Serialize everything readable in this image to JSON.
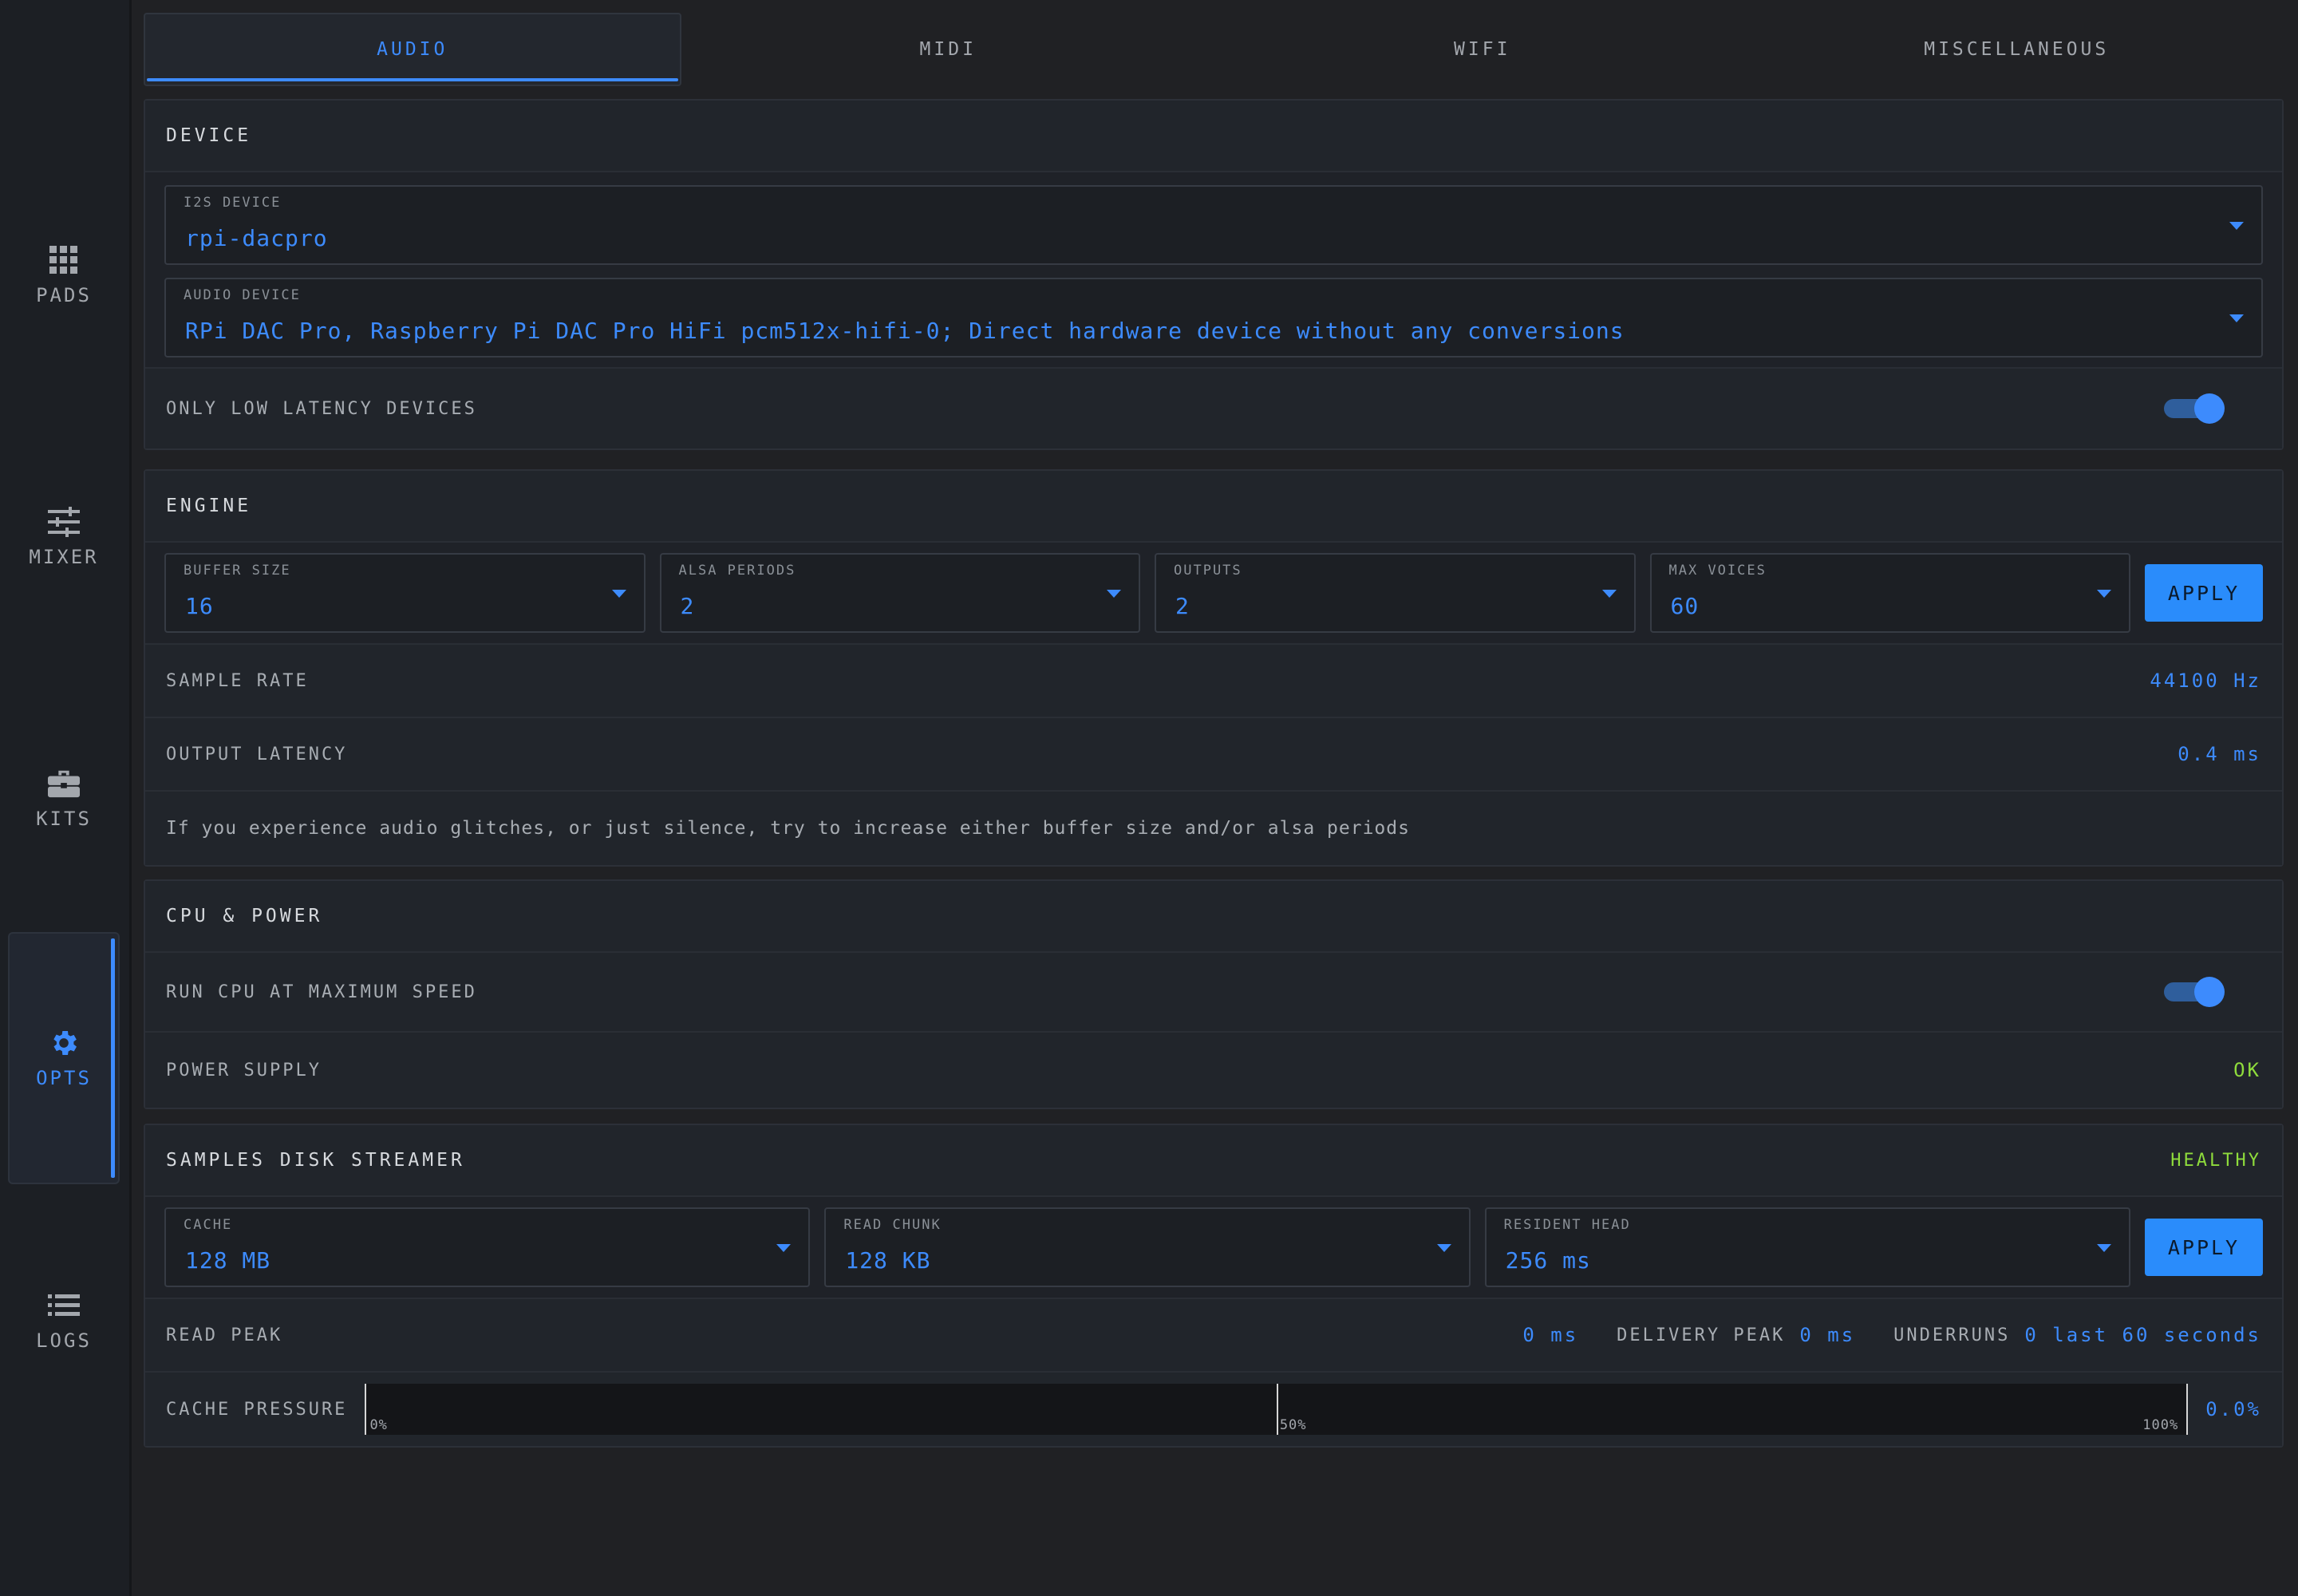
{
  "nav": {
    "items": [
      {
        "label": "PADS",
        "icon": "grid-icon"
      },
      {
        "label": "MIXER",
        "icon": "sliders-icon"
      },
      {
        "label": "KITS",
        "icon": "briefcase-icon"
      },
      {
        "label": "OPTS",
        "icon": "gear-icon"
      },
      {
        "label": "LOGS",
        "icon": "list-icon"
      }
    ],
    "active": "OPTS"
  },
  "tabs": [
    {
      "label": "AUDIO",
      "active": true
    },
    {
      "label": "MIDI"
    },
    {
      "label": "WIFI"
    },
    {
      "label": "MISCELLANEOUS"
    }
  ],
  "device": {
    "title": "DEVICE",
    "i2s_label": "I2S DEVICE",
    "i2s_value": "rpi-dacpro",
    "audio_label": "AUDIO DEVICE",
    "audio_value": "RPi DAC Pro, Raspberry Pi DAC Pro HiFi pcm512x-hifi-0; Direct hardware device without any conversions",
    "low_latency_label": "ONLY LOW LATENCY DEVICES",
    "low_latency_on": true
  },
  "engine": {
    "title": "ENGINE",
    "buffer_label": "BUFFER SIZE",
    "buffer_value": "16",
    "periods_label": "ALSA PERIODS",
    "periods_value": "2",
    "outputs_label": "OUTPUTS",
    "outputs_value": "2",
    "voices_label": "MAX VOICES",
    "voices_value": "60",
    "apply_label": "APPLY",
    "sample_rate_label": "SAMPLE RATE",
    "sample_rate_value": "44100 Hz",
    "latency_label": "OUTPUT LATENCY",
    "latency_value": "0.4 ms",
    "hint": "If you experience audio glitches, or just silence, try to increase either buffer size and/or alsa periods"
  },
  "cpu": {
    "title": "CPU & POWER",
    "max_speed_label": "RUN CPU AT MAXIMUM SPEED",
    "max_speed_on": true,
    "power_label": "POWER SUPPLY",
    "power_value": "OK"
  },
  "streamer": {
    "title": "SAMPLES DISK STREAMER",
    "status": "HEALTHY",
    "cache_label": "CACHE",
    "cache_value": "128 MB",
    "chunk_label": "READ CHUNK",
    "chunk_value": "128 KB",
    "head_label": "RESIDENT HEAD",
    "head_value": "256 ms",
    "apply_label": "APPLY",
    "read_peak_label": "READ PEAK",
    "read_peak_value": "0 ms",
    "delivery_peak_label": "DELIVERY PEAK",
    "delivery_peak_value": "0 ms",
    "underruns_label": "UNDERRUNS",
    "underruns_value": "0 last 60 seconds",
    "pressure_label": "CACHE PRESSURE",
    "pressure_ticks": [
      "0%",
      "50%",
      "100%"
    ],
    "pressure_value": "0.0%",
    "pressure_fraction": 0.0
  },
  "colors": {
    "accent": "#3d8bfd",
    "ok": "#8fdc3c",
    "bg": "#202124"
  }
}
